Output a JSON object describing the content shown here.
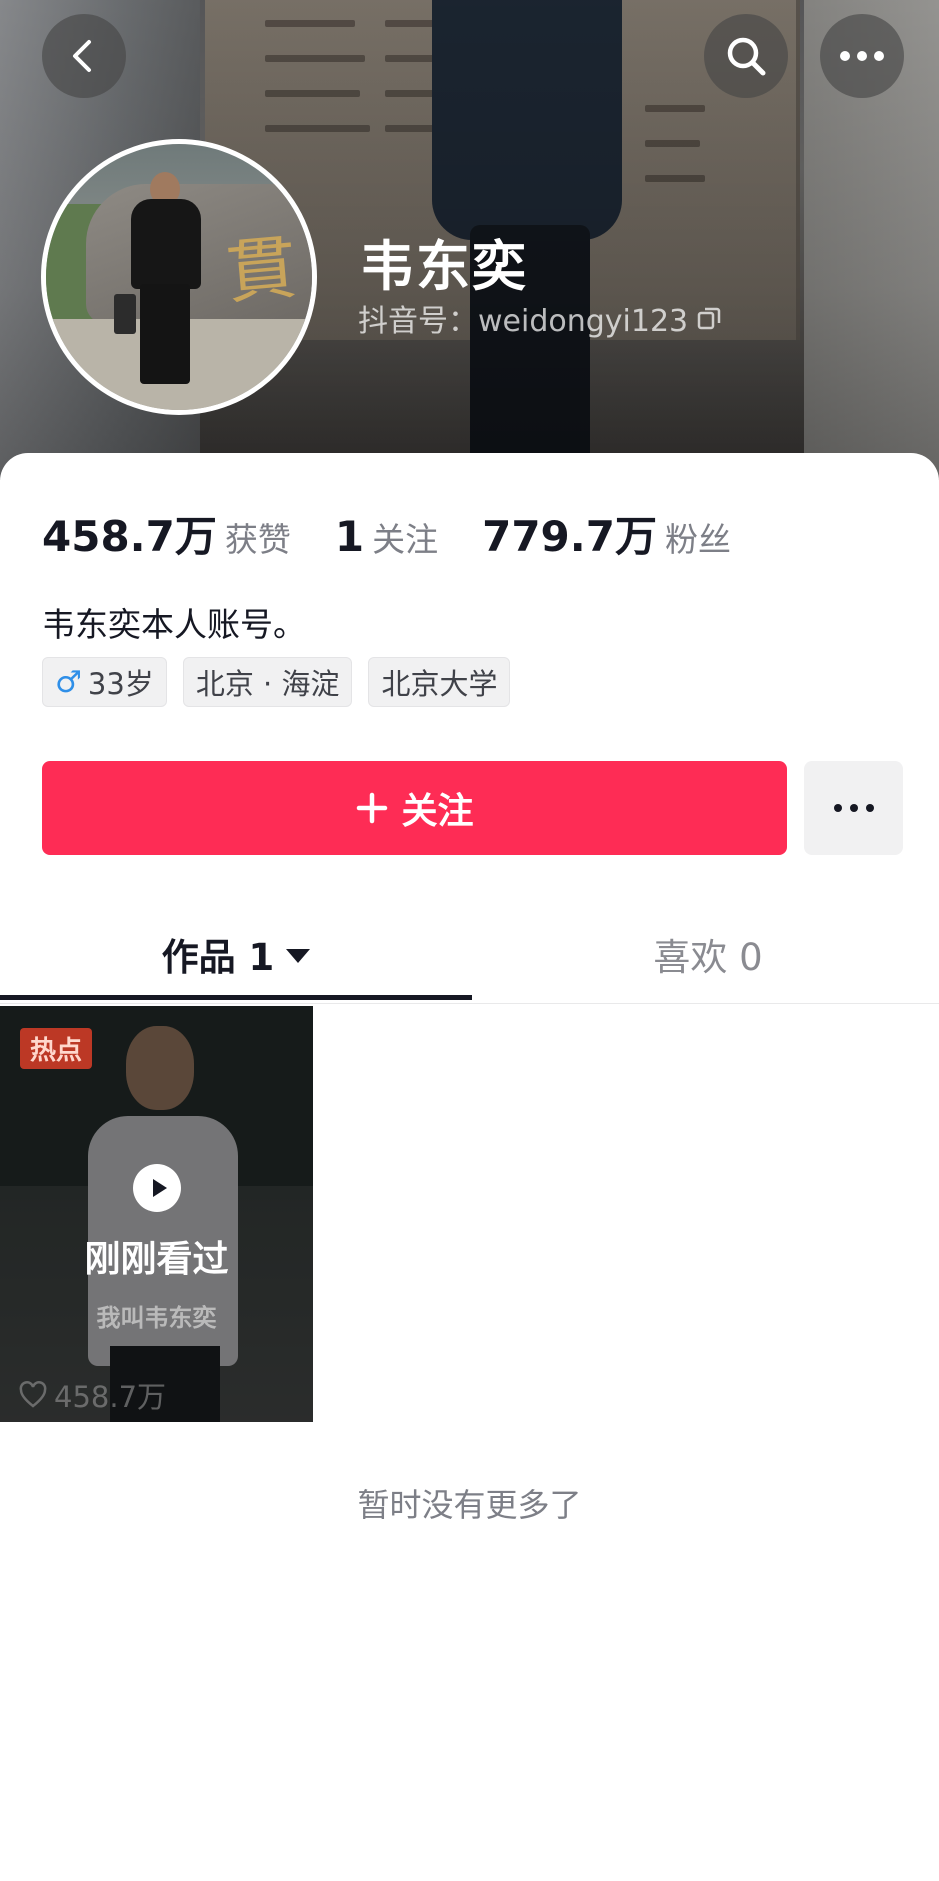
{
  "header": {
    "back_icon": "chevron-left-icon",
    "search_icon": "search-icon",
    "more_icon": "more-dots-icon",
    "name": "韦东奕",
    "douyin_id": "抖音号：weidongyi123",
    "copy_icon": "copy-icon"
  },
  "stats": {
    "likes_value": "458.7万",
    "likes_label": "获赞",
    "following_value": "1",
    "following_label": "关注",
    "followers_value": "779.7万",
    "followers_label": "粉丝"
  },
  "bio": "韦东奕本人账号。",
  "tags": {
    "gender_symbol": "♂",
    "age": "33岁",
    "location": "北京 · 海淀",
    "school": "北京大学"
  },
  "actions": {
    "follow_label": "关注",
    "follow_icon": "plus-icon",
    "more_icon": "more-dots-icon"
  },
  "tabs": {
    "works_label": "作品 1",
    "likes_label": "喜欢 0"
  },
  "video": {
    "badge": "热点",
    "watched_label": "刚刚看过",
    "subtitle": "我叫韦东奕",
    "like_count": "458.7万",
    "heart_icon": "heart-icon",
    "play_icon": "play-icon"
  },
  "footer": {
    "no_more_text": "暂时没有更多了"
  },
  "colors": {
    "accent": "#fe2c55",
    "text_primary": "#161823",
    "text_secondary": "#7d7f87",
    "tag_bg": "#f1f1f2",
    "male_blue": "#2f8fe8"
  }
}
